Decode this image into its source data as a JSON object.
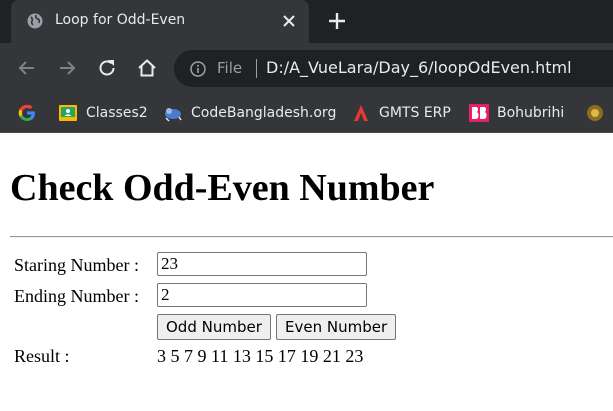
{
  "browser": {
    "tab_title": "Loop for Odd-Even",
    "url_scheme": "File",
    "url": "D:/A_VueLara/Day_6/loopOdEven.html",
    "bookmarks": [
      {
        "label": "",
        "icon": "google-icon"
      },
      {
        "label": "Classes2",
        "icon": "classroom-icon"
      },
      {
        "label": "CodeBangladesh.org",
        "icon": "codebangladesh-icon"
      },
      {
        "label": "GMTS ERP",
        "icon": "gmts-icon"
      },
      {
        "label": "Bohubrihi",
        "icon": "bohubrihi-icon"
      }
    ]
  },
  "page": {
    "heading": "Check Odd-Even Number",
    "start_label": "Staring Number :",
    "start_value": "23",
    "end_label": "Ending Number :",
    "end_value": "2",
    "odd_button": "Odd Number",
    "even_button": "Even Number",
    "result_label": "Result :",
    "result_value": "3 5 7 9 11 13 15 17 19 21 23"
  },
  "colors": {
    "tab_bar": "#202124",
    "toolbar": "#35363a",
    "text_light": "#e8eaed"
  }
}
